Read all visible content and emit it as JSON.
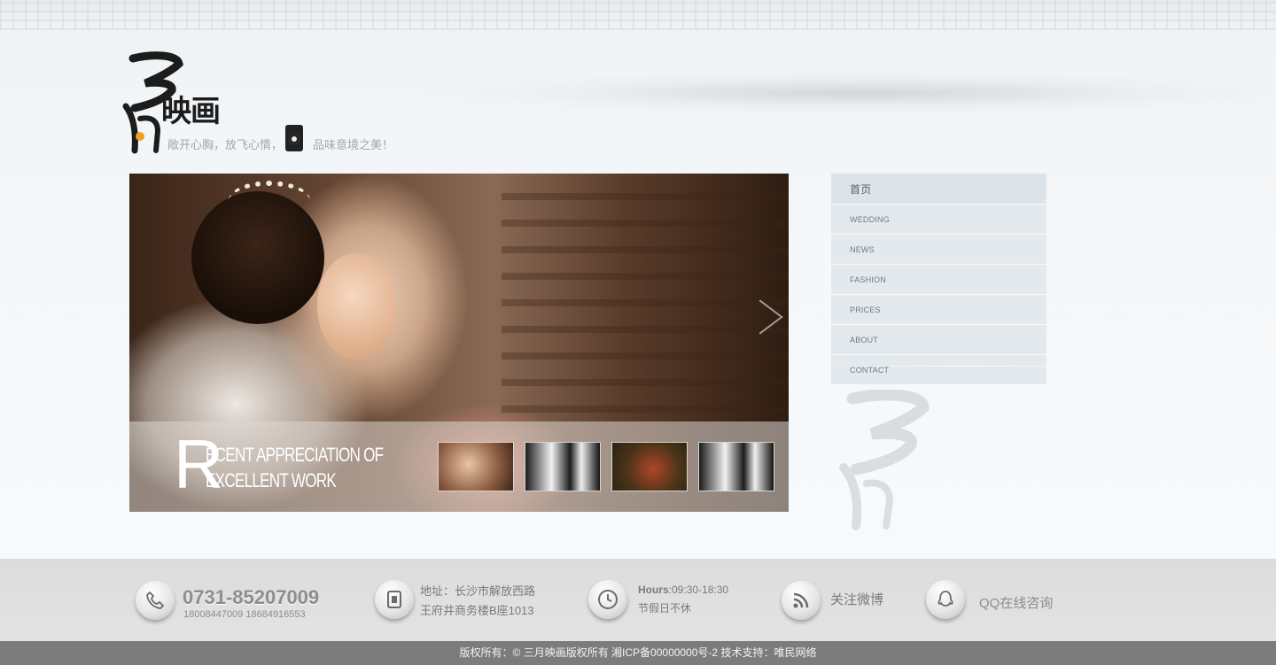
{
  "logo": {
    "brand": "映画",
    "slogan_a": "敞开心胸，放飞心情，",
    "slogan_b": "品味意境之美！"
  },
  "banner": {
    "caption_initial": "R",
    "caption_line1": "ECENT APPRECIATION OF",
    "caption_line2": "EXCELLENT WORK"
  },
  "nav": {
    "items": [
      {
        "label": "首页"
      },
      {
        "label": "WEDDING"
      },
      {
        "label": "NEWS"
      },
      {
        "label": "FASHION"
      },
      {
        "label": "PRICES"
      },
      {
        "label": "ABOUT"
      },
      {
        "label": "CONTACT"
      }
    ]
  },
  "footer": {
    "phone_main": "0731-85207009",
    "phone_alt": "18008447009  18684916553",
    "address_line1": "地址：长沙市解放西路",
    "address_line2": "王府井商务楼B座1013",
    "hours_label": "Hours",
    "hours_value": ":09:30-18:30",
    "hours_note": "节假日不休",
    "weibo": "关注微博",
    "qq": "QQ在线咨询"
  },
  "copyright": "版权所有：© 三月映画版权所有  湘ICP备00000000号-2  技术支持：唯民网络",
  "colors": {
    "nav_bg": "#e3e9ed",
    "footer_bg": "#e0e0e0",
    "copyright_bg": "#7c7c7c"
  }
}
